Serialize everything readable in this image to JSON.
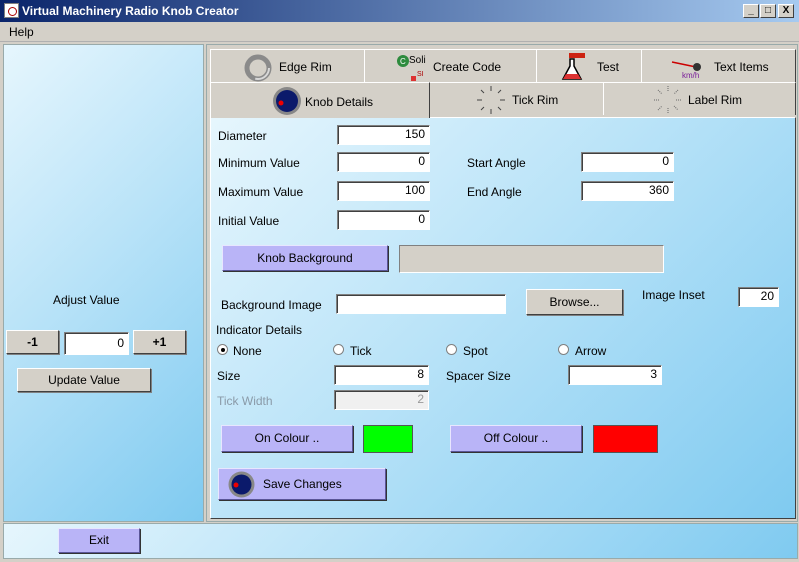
{
  "window": {
    "title": "Virtual Machinery Radio Knob Creator",
    "minimize": "_",
    "maximize": "□",
    "close": "X"
  },
  "menu": {
    "help": "Help"
  },
  "left": {
    "adjust_label": "Adjust Value",
    "minus_label": "-1",
    "plus_label": "+1",
    "value": "0",
    "update_label": "Update Value"
  },
  "tabs": {
    "row1": [
      "Edge Rim",
      "Create Code",
      "Test",
      "Text Items"
    ],
    "row2": [
      "Knob Details",
      "Tick Rim",
      "Label Rim"
    ],
    "code_icon_text": "Soli",
    "code_icon_text2": "SI",
    "kmh": "km/h",
    "active": "Knob Details"
  },
  "form": {
    "diameter_label": "Diameter",
    "diameter": "150",
    "min_label": "Minimum Value",
    "min": "0",
    "max_label": "Maximum Value",
    "max": "100",
    "initial_label": "Initial Value",
    "initial": "0",
    "start_angle_label": "Start Angle",
    "start_angle": "0",
    "end_angle_label": "End Angle",
    "end_angle": "360",
    "knob_bg_label": "Knob Background",
    "bg_image_label": "Background Image",
    "bg_image": "",
    "browse_label": "Browse...",
    "inset_label": "Image Inset",
    "inset": "20",
    "indicator_label": "Indicator Details",
    "radios": [
      "None",
      "Tick",
      "Spot",
      "Arrow"
    ],
    "radio_selected": "None",
    "size_label": "Size",
    "size": "8",
    "spacer_label": "Spacer Size",
    "spacer": "3",
    "tick_width_label": "Tick Width",
    "tick_width": "2",
    "on_colour_label": "On Colour ..",
    "on_colour": "#00ff00",
    "off_colour_label": "Off Colour ..",
    "off_colour": "#ff0000",
    "save_label": "Save Changes"
  },
  "bottom": {
    "exit_label": "Exit"
  }
}
